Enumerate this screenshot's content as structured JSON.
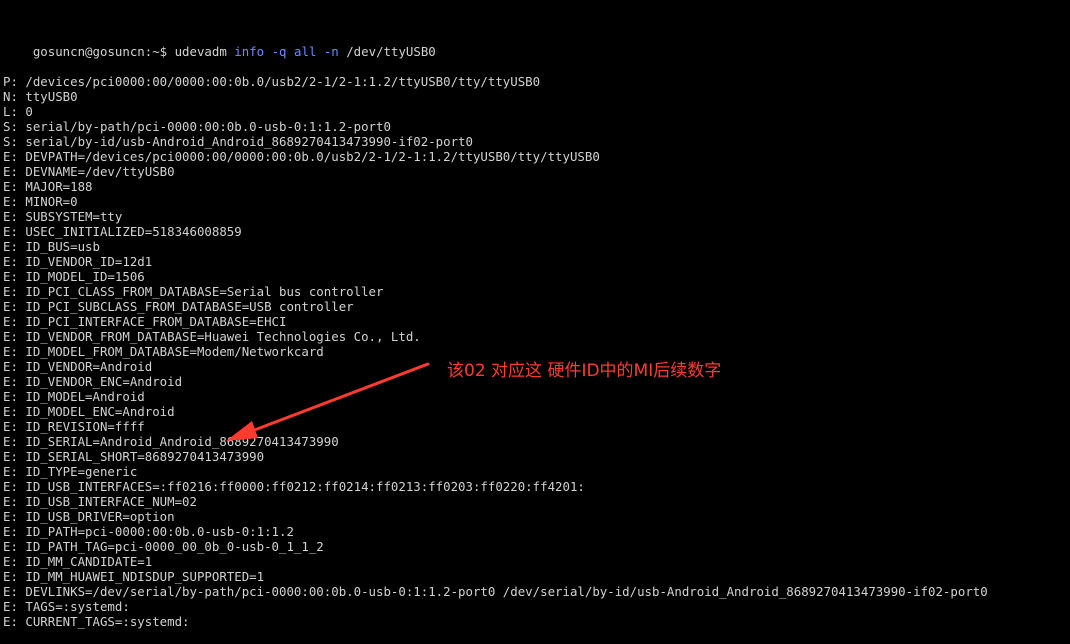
{
  "terminal": {
    "prompt": "gosuncn@gosuncn:~$ ",
    "cmd_parts": [
      "udevadm ",
      "info",
      " ",
      "-q",
      " ",
      "all",
      " ",
      "-n",
      " /dev/ttyUSB0"
    ],
    "lines": [
      "P: /devices/pci0000:00/0000:00:0b.0/usb2/2-1/2-1:1.2/ttyUSB0/tty/ttyUSB0",
      "N: ttyUSB0",
      "L: 0",
      "S: serial/by-path/pci-0000:00:0b.0-usb-0:1:1.2-port0",
      "S: serial/by-id/usb-Android_Android_8689270413473990-if02-port0",
      "E: DEVPATH=/devices/pci0000:00/0000:00:0b.0/usb2/2-1/2-1:1.2/ttyUSB0/tty/ttyUSB0",
      "E: DEVNAME=/dev/ttyUSB0",
      "E: MAJOR=188",
      "E: MINOR=0",
      "E: SUBSYSTEM=tty",
      "E: USEC_INITIALIZED=518346008859",
      "E: ID_BUS=usb",
      "E: ID_VENDOR_ID=12d1",
      "E: ID_MODEL_ID=1506",
      "E: ID_PCI_CLASS_FROM_DATABASE=Serial bus controller",
      "E: ID_PCI_SUBCLASS_FROM_DATABASE=USB controller",
      "E: ID_PCI_INTERFACE_FROM_DATABASE=EHCI",
      "E: ID_VENDOR_FROM_DATABASE=Huawei Technologies Co., Ltd.",
      "E: ID_MODEL_FROM_DATABASE=Modem/Networkcard",
      "E: ID_VENDOR=Android",
      "E: ID_VENDOR_ENC=Android",
      "E: ID_MODEL=Android",
      "E: ID_MODEL_ENC=Android",
      "E: ID_REVISION=ffff",
      "E: ID_SERIAL=Android_Android_8689270413473990",
      "E: ID_SERIAL_SHORT=8689270413473990",
      "E: ID_TYPE=generic",
      "E: ID_USB_INTERFACES=:ff0216:ff0000:ff0212:ff0214:ff0213:ff0203:ff0220:ff4201:",
      "E: ID_USB_INTERFACE_NUM=02",
      "E: ID_USB_DRIVER=option",
      "E: ID_PATH=pci-0000:00:0b.0-usb-0:1:1.2",
      "E: ID_PATH_TAG=pci-0000_00_0b_0-usb-0_1_1_2",
      "E: ID_MM_CANDIDATE=1",
      "E: ID_MM_HUAWEI_NDISDUP_SUPPORTED=1",
      "E: DEVLINKS=/dev/serial/by-path/pci-0000:00:0b.0-usb-0:1:1.2-port0 /dev/serial/by-id/usb-Android_Android_8689270413473990-if02-port0",
      "E: TAGS=:systemd:",
      "E: CURRENT_TAGS=:systemd:"
    ]
  },
  "annotation": {
    "text": "该02 对应这 硬件ID中的MI后续数字",
    "color": "#ff3b30"
  },
  "colors": {
    "background": "#000000",
    "text": "#d2d2d2",
    "keyword": "#6b8bff"
  }
}
